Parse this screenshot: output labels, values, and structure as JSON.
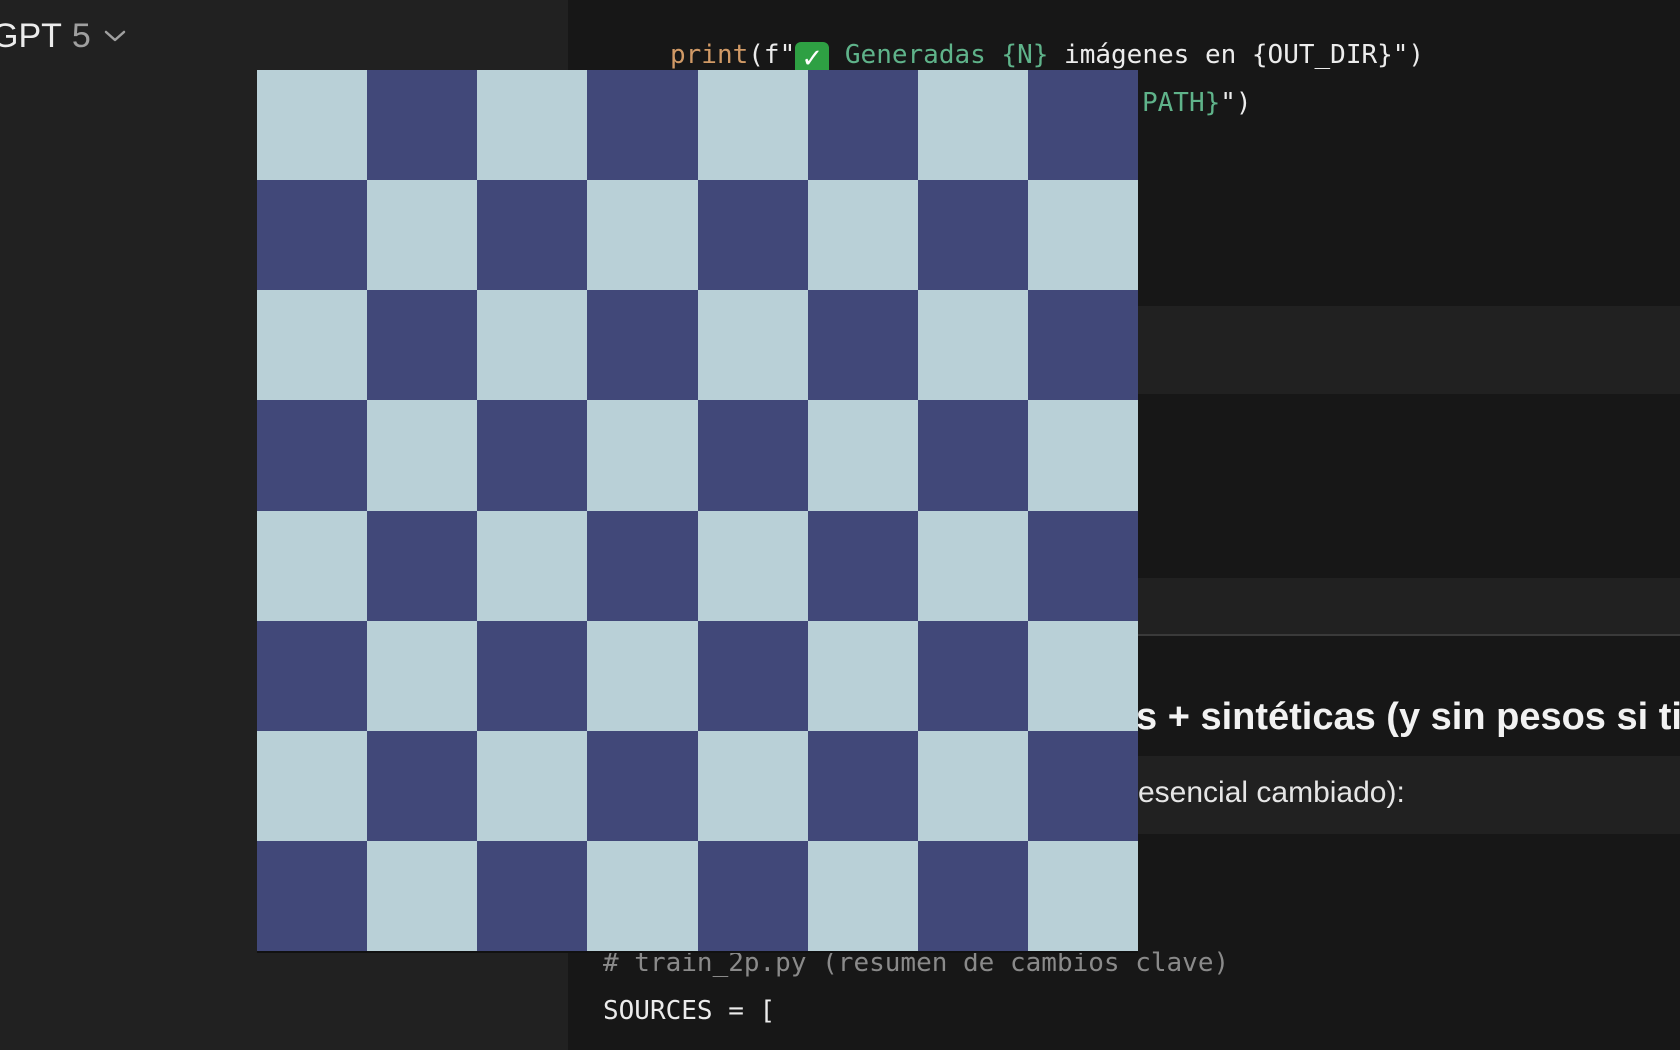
{
  "model_selector": {
    "name": "GPT",
    "version": "5",
    "icon": "chevron-down-icon"
  },
  "code_top": {
    "line1": {
      "fn": "print",
      "open": "(f\"",
      "emoji": "✓",
      "string": " Generadas {N}",
      "rest": " imágenes en {OUT_DIR}\")"
    },
    "line2": {
      "string": "PATH}",
      "rest": "\")"
    }
  },
  "heading_fragment": "s + sintéticas (y sin pesos si ti",
  "paragraph_fragment": "esencial cambiado):",
  "code_bottom": {
    "comment": "# train_2p.py (resumen de cambios clave)",
    "line": "SOURCES = ["
  },
  "board": {
    "rows": 8,
    "cols": 8,
    "light_color": "#b9d0d7",
    "dark_color": "#414879",
    "top_left": "light"
  }
}
